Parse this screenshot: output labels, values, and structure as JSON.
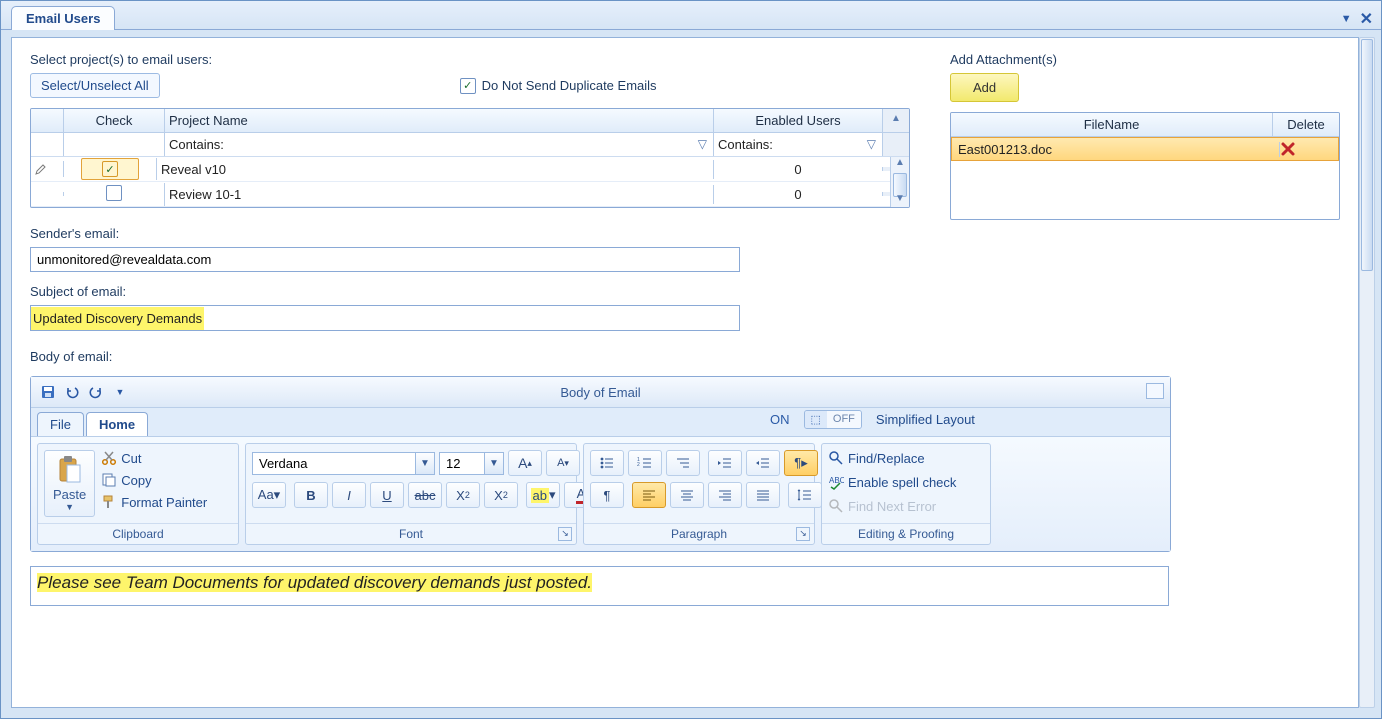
{
  "tab_title": "Email Users",
  "select_projects_label": "Select project(s) to email users:",
  "select_unselect_btn": "Select/Unselect All",
  "no_dup_label": "Do Not Send Duplicate Emails",
  "no_dup_checked": "✓",
  "projects": {
    "col_check": "Check",
    "col_name": "Project Name",
    "col_users": "Enabled  Users",
    "filter_text": "Contains:",
    "rows": [
      {
        "checked": "✓",
        "name": "Reveal v10",
        "users": "0",
        "selected": true
      },
      {
        "checked": "",
        "name": "Review 10-1",
        "users": "0",
        "selected": false
      }
    ]
  },
  "attachments": {
    "label": "Add Attachment(s)",
    "add_btn": "Add",
    "col_file": "FileName",
    "col_delete": "Delete",
    "rows": [
      {
        "file": "East001213.doc"
      }
    ]
  },
  "sender_label": "Sender's email:",
  "sender_value": "unmonitored@revealdata.com",
  "subject_label": "Subject of email:",
  "subject_value": "Updated Discovery Demands",
  "body_label": "Body of email:",
  "editor": {
    "title": "Body  of Email",
    "tab_file": "File",
    "tab_home": "Home",
    "switch_on": "ON",
    "switch_off": "OFF",
    "simplified": "Simplified Layout",
    "clipboard": {
      "paste": "Paste",
      "cut": "Cut",
      "copy": "Copy",
      "format_painter": "Format Painter",
      "group": "Clipboard"
    },
    "font": {
      "name": "Verdana",
      "size": "12",
      "group": "Font"
    },
    "paragraph": {
      "group": "Paragraph"
    },
    "editing": {
      "find": "Find/Replace",
      "spell": "Enable spell check",
      "next": "Find Next Error",
      "group": "Editing & Proofing"
    }
  },
  "body_text": "Please see Team Documents for updated discovery demands just posted."
}
